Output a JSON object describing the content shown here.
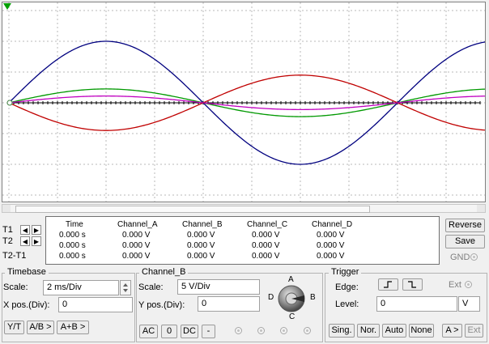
{
  "readout": {
    "headers": [
      "Time",
      "Channel_A",
      "Channel_B",
      "Channel_C",
      "Channel_D"
    ],
    "rows": [
      [
        "0.000 s",
        "0.000 V",
        "0.000 V",
        "0.000 V",
        "0.000 V"
      ],
      [
        "0.000 s",
        "0.000 V",
        "0.000 V",
        "0.000 V",
        "0.000 V"
      ],
      [
        "0.000 s",
        "0.000 V",
        "0.000 V",
        "0.000 V",
        "0.000 V"
      ]
    ]
  },
  "cursors": {
    "t1": "T1",
    "t2": "T2",
    "t2t1": "T2-T1",
    "left_arrow": "◀",
    "right_arrow": "▶"
  },
  "right_panel": {
    "reverse": "Reverse",
    "save": "Save",
    "gnd": "GND"
  },
  "timebase": {
    "title": "Timebase",
    "scale_label": "Scale:",
    "scale_value": "2 ms/Div",
    "xpos_label": "X pos.(Div):",
    "xpos_value": "0",
    "yt": "Y/T",
    "ab": "A/B >",
    "apb": "A+B >"
  },
  "channel_b": {
    "title": "Channel_B",
    "scale_label": "Scale:",
    "scale_value": "5  V/Div",
    "ypos_label": "Y pos.(Div):",
    "ypos_value": "0",
    "ac": "AC",
    "zero": "0",
    "dc": "DC",
    "minus": "-",
    "knob": {
      "a": "A",
      "b": "B",
      "c": "C",
      "d": "D"
    }
  },
  "trigger": {
    "title": "Trigger",
    "edge_label": "Edge:",
    "ext_label": "Ext",
    "level_label": "Level:",
    "level_value": "0",
    "level_unit": "V",
    "sing": "Sing.",
    "nor": "Nor.",
    "auto": "Auto",
    "none": "None",
    "a_src": "A >",
    "ext_src": "Ext"
  },
  "traces": {
    "blue": {
      "color": "#00007f",
      "amplitude_div": 2,
      "cycles": 1.25
    },
    "red": {
      "color": "#c00000",
      "amplitude_div": -0.9,
      "cycles": 1.25
    },
    "green": {
      "color": "#009900",
      "amplitude_div": 0.45,
      "cycles": 1.25
    },
    "magenta": {
      "color": "#c000c0",
      "amplitude_div": 0.22,
      "cycles": 1.25
    }
  }
}
